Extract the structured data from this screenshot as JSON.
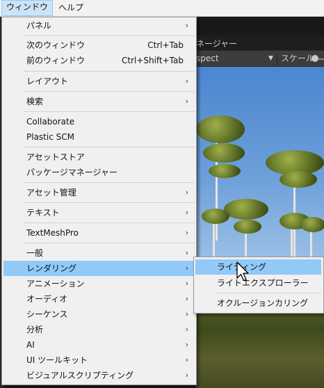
{
  "menubar": {
    "items": [
      {
        "label": "ウィンドウ"
      },
      {
        "label": "ヘルプ"
      }
    ]
  },
  "editor": {
    "tab_label": "ネージャー",
    "aspect_label": "spect",
    "scale_label": "スケール"
  },
  "main_menu": {
    "items": [
      {
        "label": "パネル",
        "submenu": true
      },
      {
        "label": "次のウィンドウ",
        "shortcut": "Ctrl+Tab"
      },
      {
        "label": "前のウィンドウ",
        "shortcut": "Ctrl+Shift+Tab"
      },
      {
        "label": "レイアウト",
        "submenu": true
      },
      {
        "label": "検索",
        "submenu": true
      },
      {
        "label": "Collaborate"
      },
      {
        "label": "Plastic SCM"
      },
      {
        "label": "アセットストア"
      },
      {
        "label": "パッケージマネージャー"
      },
      {
        "label": "アセット管理",
        "submenu": true
      },
      {
        "label": "テキスト",
        "submenu": true
      },
      {
        "label": "TextMeshPro",
        "submenu": true
      },
      {
        "label": "一般",
        "submenu": true
      },
      {
        "label": "レンダリング",
        "submenu": true,
        "highlighted": true
      },
      {
        "label": "アニメーション",
        "submenu": true
      },
      {
        "label": "オーディオ",
        "submenu": true
      },
      {
        "label": "シーケンス",
        "submenu": true
      },
      {
        "label": "分析",
        "submenu": true
      },
      {
        "label": "AI",
        "submenu": true
      },
      {
        "label": "UI ツールキット",
        "submenu": true
      },
      {
        "label": "ビジュアルスクリプティング",
        "submenu": true
      }
    ]
  },
  "rendering_submenu": {
    "items": [
      {
        "label": "ライティング",
        "highlighted": true
      },
      {
        "label": "ライトエクスプローラー"
      },
      {
        "label": "オクルージョンカリング"
      }
    ]
  },
  "arrow_glyph": "›",
  "colors": {
    "highlight": "#91c9f7",
    "menu_bg": "#f0f0f0",
    "menubar_active": "#cce4f7"
  }
}
